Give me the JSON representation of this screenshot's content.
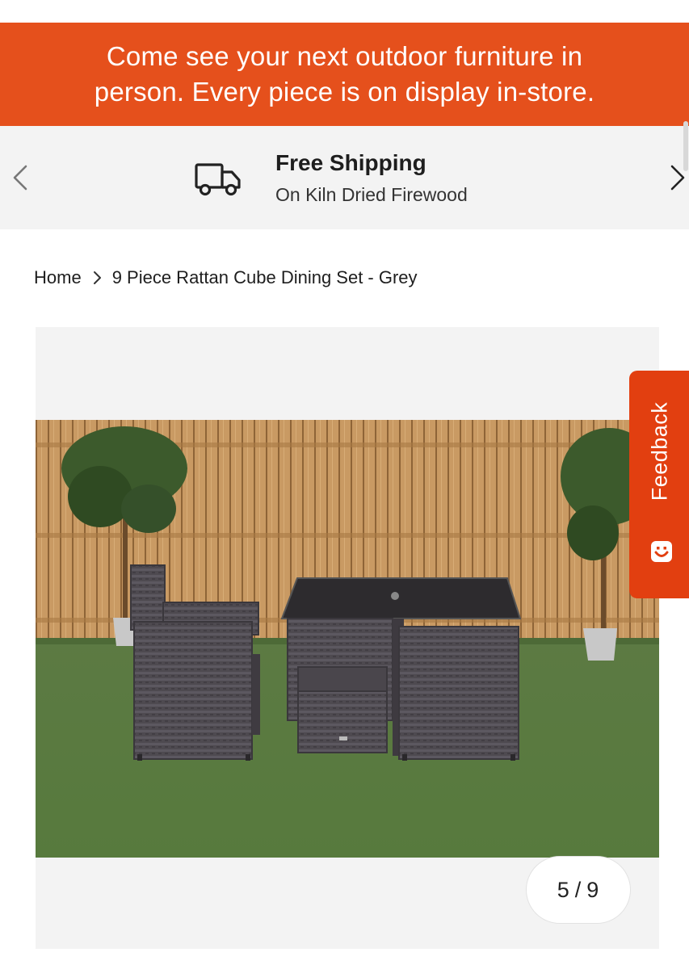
{
  "promo": {
    "line1": "Come see your next outdoor furniture in",
    "line2": "person. Every piece is on display in-store.",
    "bg_color": "#e5501c"
  },
  "shipping_bar": {
    "title": "Free Shipping",
    "subtitle": "On Kiln Dried Firewood",
    "icon": "truck-icon",
    "prev_icon": "chevron-left-icon",
    "next_icon": "chevron-right-icon"
  },
  "breadcrumb": {
    "home": "Home",
    "separator_icon": "chevron-right-icon",
    "current": "9 Piece Rattan Cube Dining Set - Grey"
  },
  "gallery": {
    "current_index": "5",
    "divider": "/",
    "total": "9",
    "image_subject": "rattan-cube-dining-set-photo"
  },
  "feedback_tab": {
    "label": "Feedback",
    "icon": "smiley-icon",
    "color": "#e23f10"
  }
}
